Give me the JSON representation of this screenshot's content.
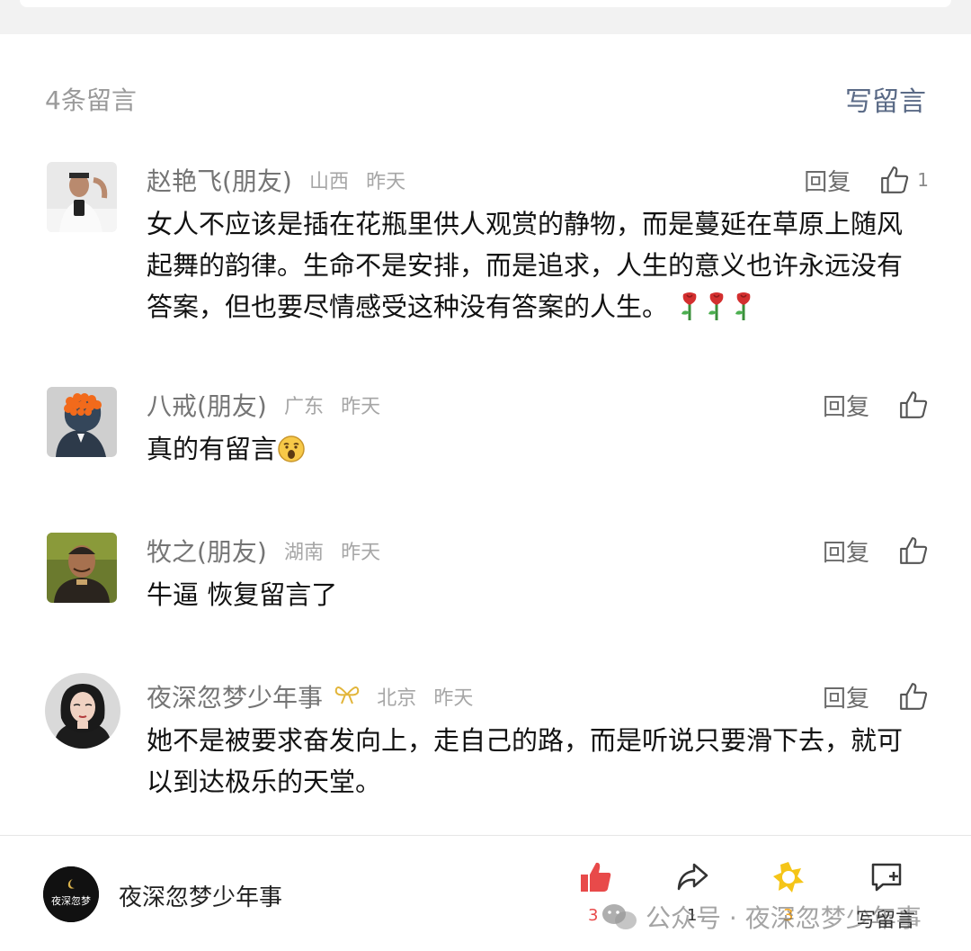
{
  "header": {
    "comment_count": "4条留言",
    "write_comment": "写留言"
  },
  "comments": [
    {
      "name": "赵艳飞(朋友)",
      "region": "山西",
      "time": "昨天",
      "reply": "回复",
      "likes": "1",
      "text": "女人不应该是插在花瓶里供人观赏的静物，而是蔓延在草原上随风起舞的韵律。生命不是安排，而是追求，人生的意义也许永远没有答案，但也要尽情感受这种没有答案的人生。",
      "emoji": [
        "rose-emoji",
        "rose-emoji",
        "rose-emoji"
      ]
    },
    {
      "name": "八戒(朋友)",
      "region": "广东",
      "time": "昨天",
      "reply": "回复",
      "text": "真的有留言",
      "emoji": [
        "surprised-face-emoji"
      ]
    },
    {
      "name": "牧之(朋友)",
      "region": "湖南",
      "time": "昨天",
      "reply": "回复",
      "text": "牛逼 恢复留言了"
    },
    {
      "name": "夜深忽梦少年事",
      "region": "北京",
      "time": "昨天",
      "reply": "回复",
      "text": "她不是被要求奋发向上，走自己的路，而是听说只要滑下去，就可以到达极乐的天堂。",
      "badge_icon": "bow-icon"
    }
  ],
  "bottom_bar": {
    "account_name": "夜深忽梦少年事",
    "logo_text": "夜深忽梦",
    "like_count": "3",
    "share_count": "1",
    "wow_count": "3",
    "write_label": "写留言",
    "watermark": "公众号 · 夜深忽梦少年事",
    "accent_color": "#e84a4a",
    "star_color": "#f5c518"
  }
}
